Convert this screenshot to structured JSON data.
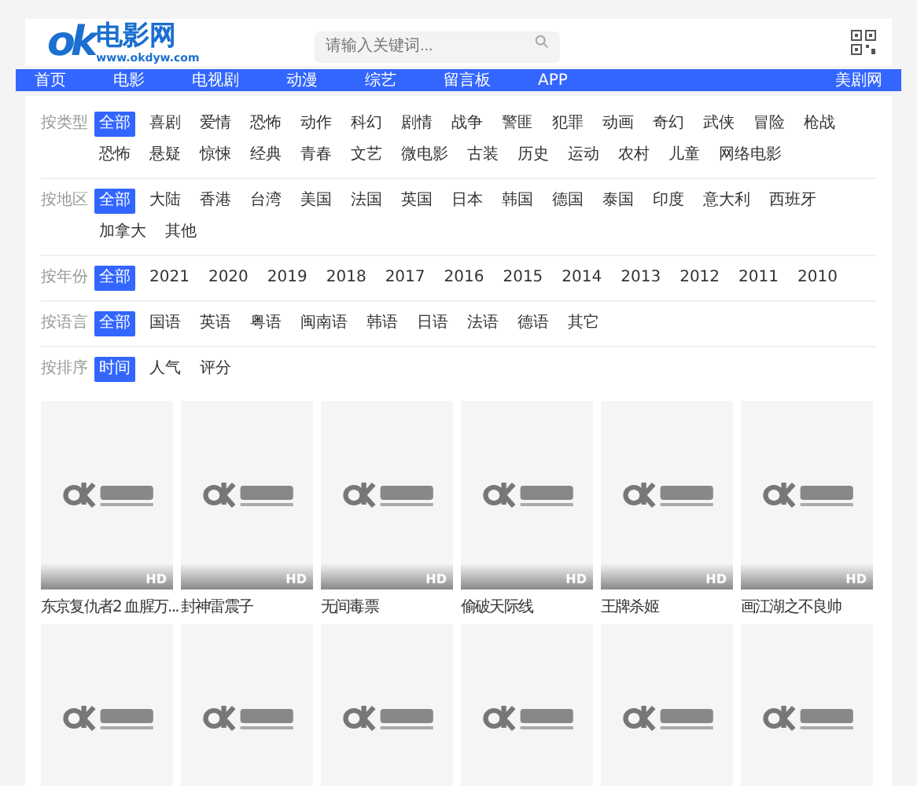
{
  "header": {
    "logo": {
      "mark": "ok",
      "name": "电影网",
      "url": "www.okdyw.com"
    },
    "search": {
      "placeholder": "请输入关键词..."
    }
  },
  "nav": {
    "items": [
      {
        "label": "首页",
        "selected": false
      },
      {
        "label": "电影",
        "selected": false
      },
      {
        "label": "电视剧",
        "selected": false
      },
      {
        "label": "动漫",
        "selected": false
      },
      {
        "label": "综艺",
        "selected": false
      },
      {
        "label": "留言板",
        "selected": false
      },
      {
        "label": "APP",
        "selected": false
      }
    ],
    "right_link": "美剧网"
  },
  "filters": [
    {
      "label": "按类型",
      "options": [
        {
          "label": "全部",
          "selected": true
        },
        {
          "label": "喜剧",
          "selected": false
        },
        {
          "label": "爱情",
          "selected": false
        },
        {
          "label": "恐怖",
          "selected": false
        },
        {
          "label": "动作",
          "selected": false
        },
        {
          "label": "科幻",
          "selected": false
        },
        {
          "label": "剧情",
          "selected": false
        },
        {
          "label": "战争",
          "selected": false
        },
        {
          "label": "警匪",
          "selected": false
        },
        {
          "label": "犯罪",
          "selected": false
        },
        {
          "label": "动画",
          "selected": false
        },
        {
          "label": "奇幻",
          "selected": false
        },
        {
          "label": "武侠",
          "selected": false
        },
        {
          "label": "冒险",
          "selected": false
        },
        {
          "label": "枪战",
          "selected": false
        },
        {
          "label": "恐怖",
          "selected": false
        },
        {
          "label": "悬疑",
          "selected": false
        },
        {
          "label": "惊悚",
          "selected": false
        },
        {
          "label": "经典",
          "selected": false
        },
        {
          "label": "青春",
          "selected": false
        },
        {
          "label": "文艺",
          "selected": false
        },
        {
          "label": "微电影",
          "selected": false
        },
        {
          "label": "古装",
          "selected": false
        },
        {
          "label": "历史",
          "selected": false
        },
        {
          "label": "运动",
          "selected": false
        },
        {
          "label": "农村",
          "selected": false
        },
        {
          "label": "儿童",
          "selected": false
        },
        {
          "label": "网络电影",
          "selected": false
        }
      ]
    },
    {
      "label": "按地区",
      "options": [
        {
          "label": "全部",
          "selected": true
        },
        {
          "label": "大陆",
          "selected": false
        },
        {
          "label": "香港",
          "selected": false
        },
        {
          "label": "台湾",
          "selected": false
        },
        {
          "label": "美国",
          "selected": false
        },
        {
          "label": "法国",
          "selected": false
        },
        {
          "label": "英国",
          "selected": false
        },
        {
          "label": "日本",
          "selected": false
        },
        {
          "label": "韩国",
          "selected": false
        },
        {
          "label": "德国",
          "selected": false
        },
        {
          "label": "泰国",
          "selected": false
        },
        {
          "label": "印度",
          "selected": false
        },
        {
          "label": "意大利",
          "selected": false
        },
        {
          "label": "西班牙",
          "selected": false
        },
        {
          "label": "加拿大",
          "selected": false
        },
        {
          "label": "其他",
          "selected": false
        }
      ]
    },
    {
      "label": "按年份",
      "options": [
        {
          "label": "全部",
          "selected": true
        },
        {
          "label": "2021",
          "selected": false
        },
        {
          "label": "2020",
          "selected": false
        },
        {
          "label": "2019",
          "selected": false
        },
        {
          "label": "2018",
          "selected": false
        },
        {
          "label": "2017",
          "selected": false
        },
        {
          "label": "2016",
          "selected": false
        },
        {
          "label": "2015",
          "selected": false
        },
        {
          "label": "2014",
          "selected": false
        },
        {
          "label": "2013",
          "selected": false
        },
        {
          "label": "2012",
          "selected": false
        },
        {
          "label": "2011",
          "selected": false
        },
        {
          "label": "2010",
          "selected": false
        }
      ]
    },
    {
      "label": "按语言",
      "options": [
        {
          "label": "全部",
          "selected": true
        },
        {
          "label": "国语",
          "selected": false
        },
        {
          "label": "英语",
          "selected": false
        },
        {
          "label": "粤语",
          "selected": false
        },
        {
          "label": "闽南语",
          "selected": false
        },
        {
          "label": "韩语",
          "selected": false
        },
        {
          "label": "日语",
          "selected": false
        },
        {
          "label": "法语",
          "selected": false
        },
        {
          "label": "德语",
          "selected": false
        },
        {
          "label": "其它",
          "selected": false
        }
      ]
    },
    {
      "label": "按排序",
      "options": [
        {
          "label": "时间",
          "selected": true
        },
        {
          "label": "人气",
          "selected": false
        },
        {
          "label": "评分",
          "selected": false
        }
      ]
    }
  ],
  "posters": [
    {
      "kind": "titled",
      "badge": "HD",
      "title": "东京复仇者2 血腥万..."
    },
    {
      "kind": "titled",
      "badge": "HD",
      "title": "封神雷震子"
    },
    {
      "kind": "titled",
      "badge": "HD",
      "title": "无间毒票"
    },
    {
      "kind": "titled",
      "badge": "HD",
      "title": "偷破天际线"
    },
    {
      "kind": "titled",
      "badge": "HD",
      "title": "王牌杀姬"
    },
    {
      "kind": "titled",
      "badge": "HD",
      "title": "画江湖之不良帅"
    },
    {
      "kind": "picture"
    },
    {
      "kind": "picture"
    },
    {
      "kind": "picture"
    },
    {
      "kind": "picture"
    },
    {
      "kind": "picture"
    },
    {
      "kind": "picture"
    }
  ]
}
